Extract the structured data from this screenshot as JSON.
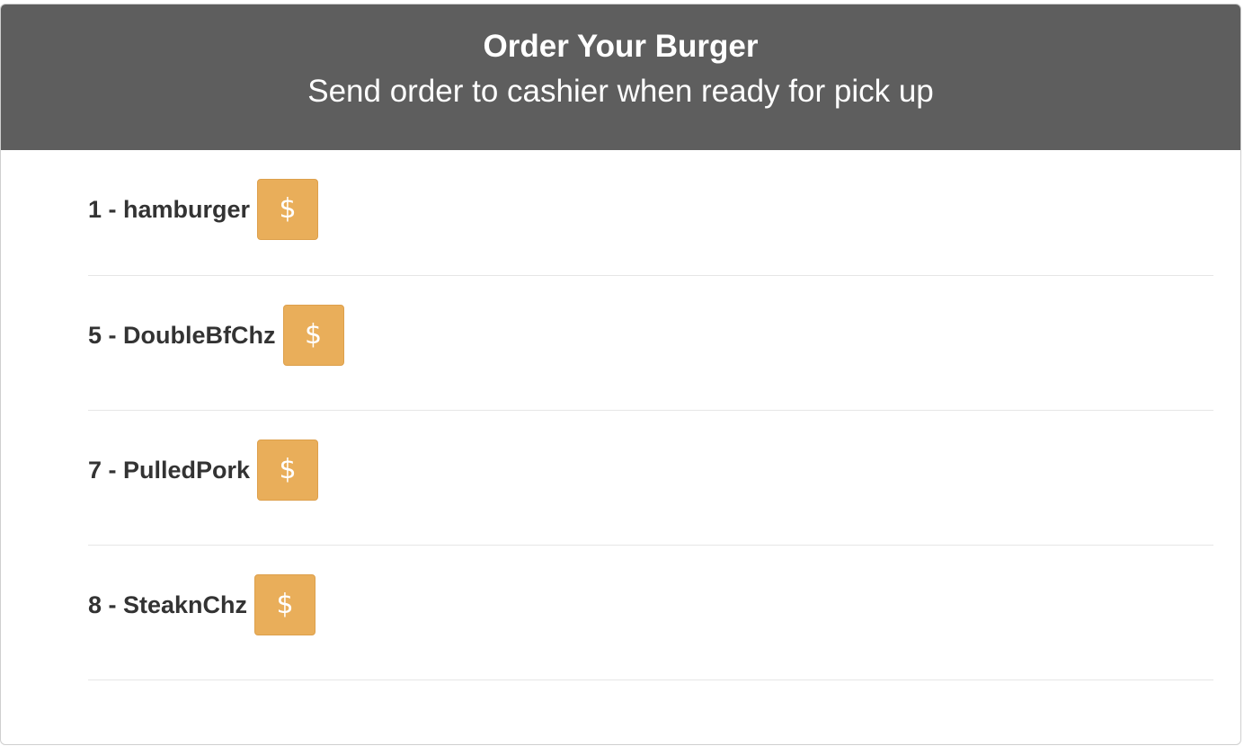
{
  "header": {
    "title": "Order Your Burger",
    "subtitle": "Send order to cashier when ready for pick up"
  },
  "orders": [
    {
      "label": "1 - hamburger",
      "button_icon": "$"
    },
    {
      "label": "5 - DoubleBfChz",
      "button_icon": "$"
    },
    {
      "label": "7 - PulledPork",
      "button_icon": "$"
    },
    {
      "label": "8 - SteaknChz",
      "button_icon": "$"
    }
  ],
  "colors": {
    "header_bg": "#5e5e5e",
    "button_bg": "#e9ae5a"
  }
}
